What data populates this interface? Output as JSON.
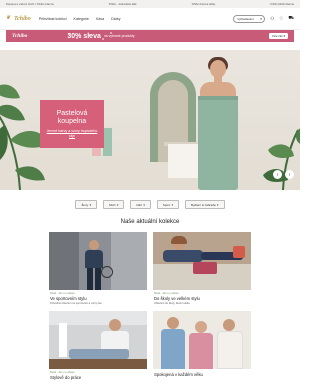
{
  "topbar": {
    "left": "Doprava a vrácení zboží v Tchibo zdarma",
    "center": "Tchibo - Jednoduše kafe",
    "right": "Tchibo Kávové dárky",
    "far_right": "Tchibo Mobil zdarma"
  },
  "header": {
    "logo": "Tchibo",
    "nav": [
      "Příležitost kolekci",
      "Kategorie",
      "Káva",
      "Dárky"
    ],
    "search_placeholder": "Vyhledávání",
    "icons": [
      "search-icon",
      "user-icon",
      "heart-icon",
      "cart-icon"
    ]
  },
  "promo": {
    "logo": "Tchibo",
    "percent": "30% sleva",
    "text": "na vybrané produkty",
    "button": "Více info"
  },
  "hero": {
    "title": "Pastelová koupelna",
    "subtitle": "Jemné barvy a vzory tropického ráje",
    "prev": "‹",
    "next": "›"
  },
  "filters": [
    {
      "label": "Ženy",
      "arrow": "▾"
    },
    {
      "label": "Muži",
      "arrow": "▾"
    },
    {
      "label": "Děti",
      "arrow": "▾"
    },
    {
      "label": "Sport",
      "arrow": "▾"
    },
    {
      "label": "Bydlení & zahrada",
      "arrow": "▾"
    }
  ],
  "section": {
    "title": "Naše aktuální kolekce"
  },
  "cards": [
    {
      "tag": "Nově · Jen v e-shopu",
      "title": "Ve sportovním stylu",
      "desc": "Pohodlné oblečení na sportování a volný čas"
    },
    {
      "tag": "Nově · Jen v e-shopu",
      "title": "Do školy ve velkém stylu",
      "desc": "Oblečení do školy, školní taška"
    },
    {
      "tag": "Nově · Jen v e-shopu",
      "title": "Stylově do práce",
      "desc": ""
    },
    {
      "tag": "",
      "title": "Spokojená v každém věku",
      "desc": ""
    }
  ],
  "colors": {
    "promo": "#c85b78",
    "hero_card": "#d65f79",
    "accent_gold": "#b89a4b",
    "tag_green": "#6c8f5c"
  }
}
